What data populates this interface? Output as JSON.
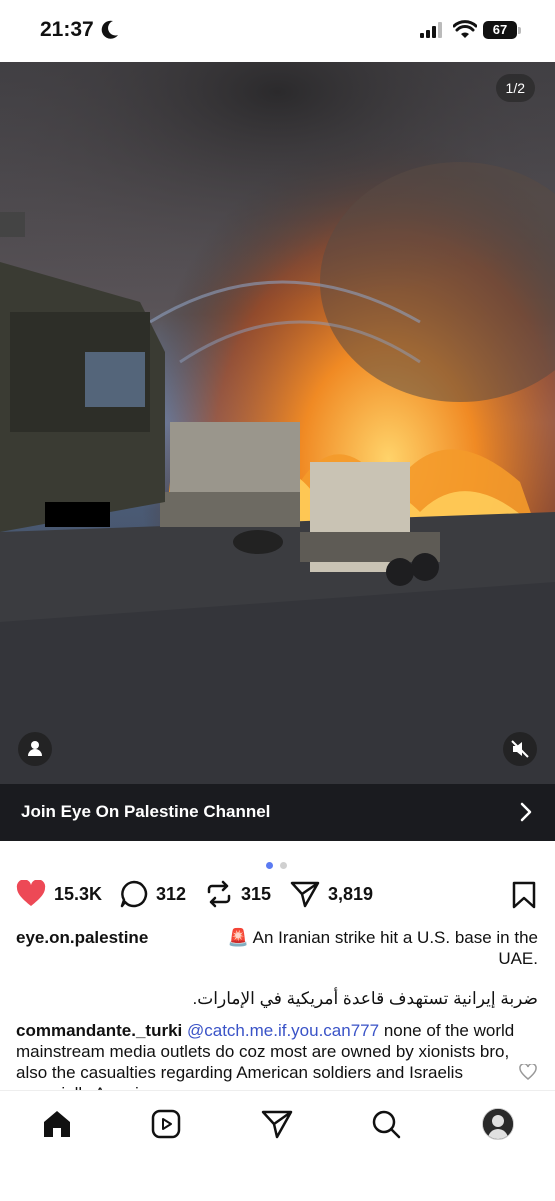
{
  "status": {
    "time": "21:37",
    "battery": "67"
  },
  "post": {
    "image_counter": "1/2",
    "cta_label": "Join Eye On Palestine Channel",
    "likes": "15.3K",
    "comments": "312",
    "reposts": "315",
    "shares": "3,819",
    "username": "eye.on.palestine",
    "caption_en": "🚨 An Iranian strike hit a U.S. base in the UAE.",
    "caption_ar": "ضربة إيرانية تستهدف قاعدة أمريكية في الإمارات."
  },
  "comment": {
    "username": "commandante._turki",
    "mention": "@catch.me.if.you.can777",
    "text": " none of the world mainstream media outlets do coz most are owned by xionists bro, also the casualties regarding American soldiers and Israelis especially American"
  },
  "colors": {
    "like_red": "#ed4956",
    "mention_blue": "#3a53c7",
    "dot_active": "#5b7bf2"
  },
  "icons": [
    "moon-icon",
    "signal-icon",
    "wifi-icon",
    "heart-icon",
    "comment-icon",
    "repost-icon",
    "share-icon",
    "bookmark-icon",
    "home-icon",
    "reels-icon",
    "send-icon",
    "search-icon",
    "person-icon",
    "mute-icon"
  ]
}
